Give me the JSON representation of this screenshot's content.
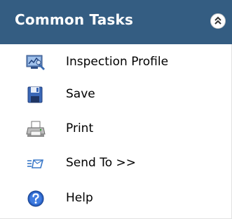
{
  "panel": {
    "title": "Common Tasks",
    "collapse_icon": "double-chevron-up-icon",
    "items": [
      {
        "label": "Inspection Profile",
        "icon": "inspection-profile-icon"
      },
      {
        "label": "Save",
        "icon": "save-icon"
      },
      {
        "label": "Print",
        "icon": "print-icon"
      },
      {
        "label": "Send To >>",
        "icon": "send-to-icon"
      },
      {
        "label": "Help",
        "icon": "help-icon"
      }
    ]
  },
  "colors": {
    "header_background": "#345d82",
    "header_text": "#ffffff",
    "item_text": "#000000"
  }
}
